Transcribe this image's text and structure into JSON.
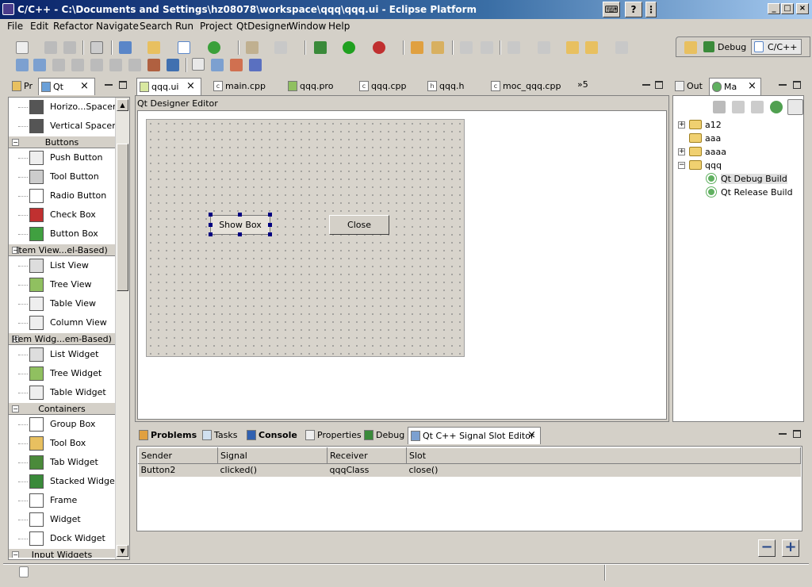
{
  "window": {
    "title": "C/C++ - C:\\Documents and Settings\\hz08078\\workspace\\qqq\\qqq.ui - Eclipse Platform",
    "min": "_",
    "max": "□",
    "close": "×",
    "sys1": "⌨",
    "sys2": "?",
    "sys3": "⋮"
  },
  "menu": [
    "File",
    "Edit",
    "Refactor",
    "Navigate",
    "Search",
    "Run",
    "Project",
    "QtDesigner",
    "Window",
    "Help"
  ],
  "perspectives": {
    "debug": "Debug",
    "cpp": "C/C++"
  },
  "left_panel": {
    "tabs": [
      "Pr",
      "Qt"
    ],
    "palette": [
      {
        "kind": "item",
        "label": "Horizo...Spacer",
        "icon": "horizontal-spacer-icon"
      },
      {
        "kind": "item",
        "label": "Vertical Spacer",
        "icon": "vertical-spacer-icon"
      },
      {
        "kind": "cat",
        "label": "Buttons"
      },
      {
        "kind": "item",
        "label": "Push Button",
        "icon": "push-button-icon"
      },
      {
        "kind": "item",
        "label": "Tool Button",
        "icon": "tool-button-icon"
      },
      {
        "kind": "item",
        "label": "Radio Button",
        "icon": "radio-button-icon"
      },
      {
        "kind": "item",
        "label": "Check Box",
        "icon": "check-box-icon"
      },
      {
        "kind": "item",
        "label": "Button Box",
        "icon": "button-box-icon"
      },
      {
        "kind": "cat",
        "label": "Item View...el-Based)"
      },
      {
        "kind": "item",
        "label": "List View",
        "icon": "list-view-icon"
      },
      {
        "kind": "item",
        "label": "Tree View",
        "icon": "tree-view-icon"
      },
      {
        "kind": "item",
        "label": "Table View",
        "icon": "table-view-icon"
      },
      {
        "kind": "item",
        "label": "Column View",
        "icon": "column-view-icon"
      },
      {
        "kind": "cat",
        "label": "Item Widg...em-Based)"
      },
      {
        "kind": "item",
        "label": "List Widget",
        "icon": "list-widget-icon"
      },
      {
        "kind": "item",
        "label": "Tree Widget",
        "icon": "tree-widget-icon"
      },
      {
        "kind": "item",
        "label": "Table Widget",
        "icon": "table-widget-icon"
      },
      {
        "kind": "cat",
        "label": "Containers"
      },
      {
        "kind": "item",
        "label": "Group Box",
        "icon": "group-box-icon"
      },
      {
        "kind": "item",
        "label": "Tool Box",
        "icon": "tool-box-icon"
      },
      {
        "kind": "item",
        "label": "Tab Widget",
        "icon": "tab-widget-icon"
      },
      {
        "kind": "item",
        "label": "Stacked Widget",
        "icon": "stacked-widget-icon"
      },
      {
        "kind": "item",
        "label": "Frame",
        "icon": "frame-icon"
      },
      {
        "kind": "item",
        "label": "Widget",
        "icon": "widget-icon"
      },
      {
        "kind": "item",
        "label": "Dock Widget",
        "icon": "dock-widget-icon"
      },
      {
        "kind": "cat",
        "label": "Input Widgets"
      }
    ]
  },
  "editor": {
    "tabs": [
      "qqq.ui",
      "main.cpp",
      "qqq.pro",
      "qqq.cpp",
      "qqq.h",
      "moc_qqq.cpp"
    ],
    "overflow": "»5",
    "header": "Qt Designer Editor",
    "form_buttons": {
      "show": "Show Box",
      "close": "Close"
    }
  },
  "right_panel": {
    "tabs": [
      "Out",
      "Ma"
    ],
    "tree": [
      {
        "label": "a12",
        "expander": "+"
      },
      {
        "label": "aaa",
        "expander": ""
      },
      {
        "label": "aaaa",
        "expander": "+"
      },
      {
        "label": "qqq",
        "expander": "−"
      },
      {
        "label": "Qt Debug Build",
        "expander": ""
      },
      {
        "label": "Qt Release Build",
        "expander": ""
      }
    ]
  },
  "bottom_panel": {
    "tabs": [
      "Problems",
      "Tasks",
      "Console",
      "Properties",
      "Debug",
      "Qt C++ Signal Slot Editor"
    ],
    "columns": [
      "Sender",
      "Signal",
      "Receiver",
      "Slot"
    ],
    "rows": [
      [
        "Button2",
        "clicked()",
        "qqqClass",
        "close()"
      ]
    ],
    "remove": "−",
    "add": "+"
  }
}
